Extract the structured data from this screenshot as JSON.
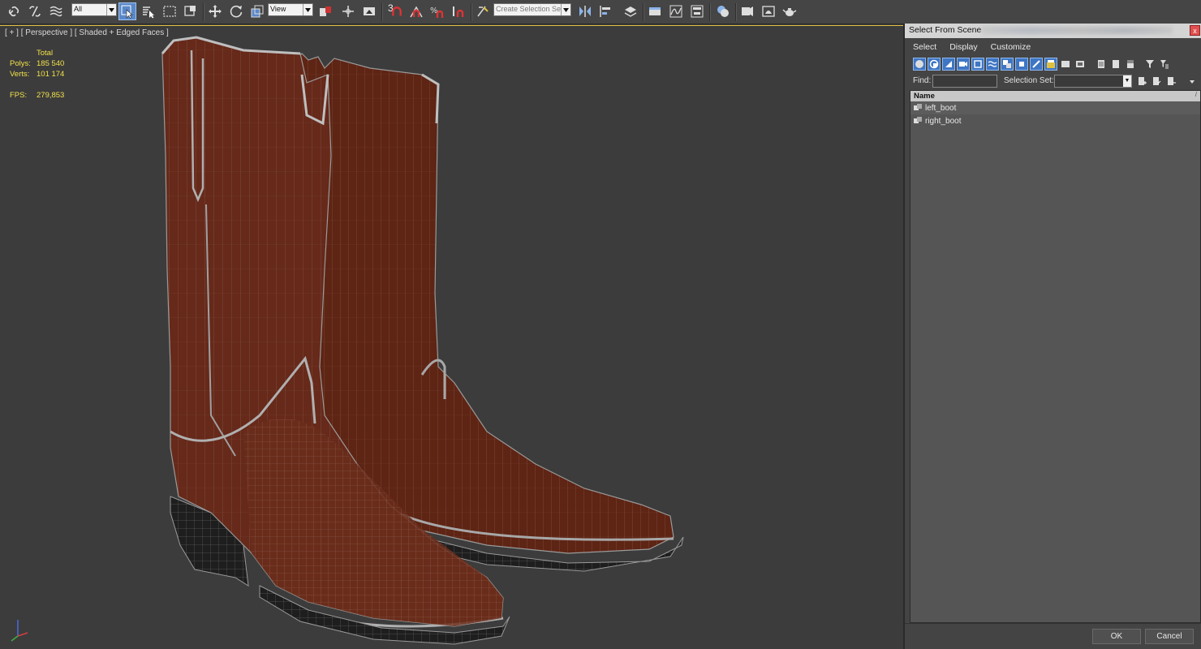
{
  "toolbar": {
    "selection_filter": "All",
    "reference_coord": "View",
    "named_selection_placeholder": "Create Selection Se",
    "snap_value": "3"
  },
  "viewport": {
    "label": "[ + ] [ Perspective ] [ Shaded + Edged Faces ]",
    "stats": {
      "total_label": "Total",
      "polys_label": "Polys:",
      "polys_value": "185 540",
      "verts_label": "Verts:",
      "verts_value": "101 174",
      "fps_label": "FPS:",
      "fps_value": "279,853"
    }
  },
  "dialog": {
    "title": "Select From Scene",
    "close": "x",
    "menu": [
      "Select",
      "Display",
      "Customize"
    ],
    "find_label": "Find:",
    "find_value": "",
    "selection_set_label": "Selection Set:",
    "selection_set_value": "",
    "column_header": "Name",
    "sort_indicator": "/",
    "objects": [
      "left_boot",
      "right_boot"
    ],
    "ok_label": "OK",
    "cancel_label": "Cancel"
  },
  "colors": {
    "accent": "#5a88c9",
    "stats_text": "#f2e14a",
    "viewport_bg": "#3c3c3c",
    "leather": "#6b2c1a"
  }
}
